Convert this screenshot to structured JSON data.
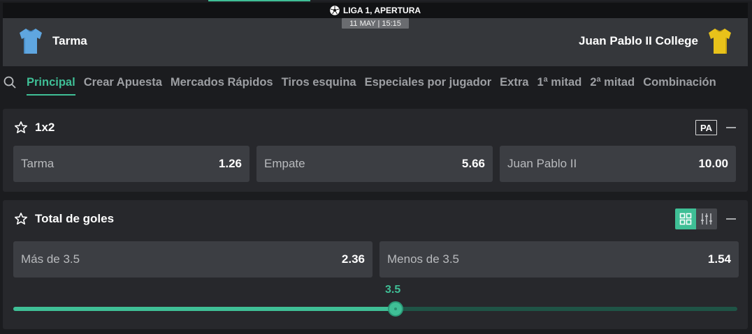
{
  "league": {
    "name": "LIGA 1, APERTURA",
    "icon": "soccer-ball-icon"
  },
  "match": {
    "datetime": "11 MAY | 15:15",
    "home": {
      "name": "Tarma",
      "jersey_color": "#5fa6e0"
    },
    "away": {
      "name": "Juan Pablo II College",
      "jersey_color": "#e8c21a"
    }
  },
  "tabs": [
    {
      "label": "Principal",
      "active": true
    },
    {
      "label": "Crear Apuesta",
      "active": false
    },
    {
      "label": "Mercados Rápidos",
      "active": false
    },
    {
      "label": "Tiros esquina",
      "active": false
    },
    {
      "label": "Especiales por jugador",
      "active": false
    },
    {
      "label": "Extra",
      "active": false
    },
    {
      "label": "1ª mitad",
      "active": false
    },
    {
      "label": "2ª mitad",
      "active": false
    },
    {
      "label": "Combinación",
      "active": false
    }
  ],
  "markets": [
    {
      "title": "1x2",
      "badge": "PA",
      "selections": [
        {
          "label": "Tarma",
          "odds": "1.26"
        },
        {
          "label": "Empate",
          "odds": "5.66"
        },
        {
          "label": "Juan Pablo II",
          "odds": "10.00"
        }
      ]
    },
    {
      "title": "Total de goles",
      "selections": [
        {
          "label": "Más de 3.5",
          "odds": "2.36"
        },
        {
          "label": "Menos de 3.5",
          "odds": "1.54"
        }
      ],
      "slider": {
        "value": "3.5",
        "fraction": 0.528
      }
    }
  ],
  "colors": {
    "accent": "#3fbf96",
    "background": "#1b1c1f",
    "panel": "#27282c",
    "button": "#3c3e43"
  }
}
